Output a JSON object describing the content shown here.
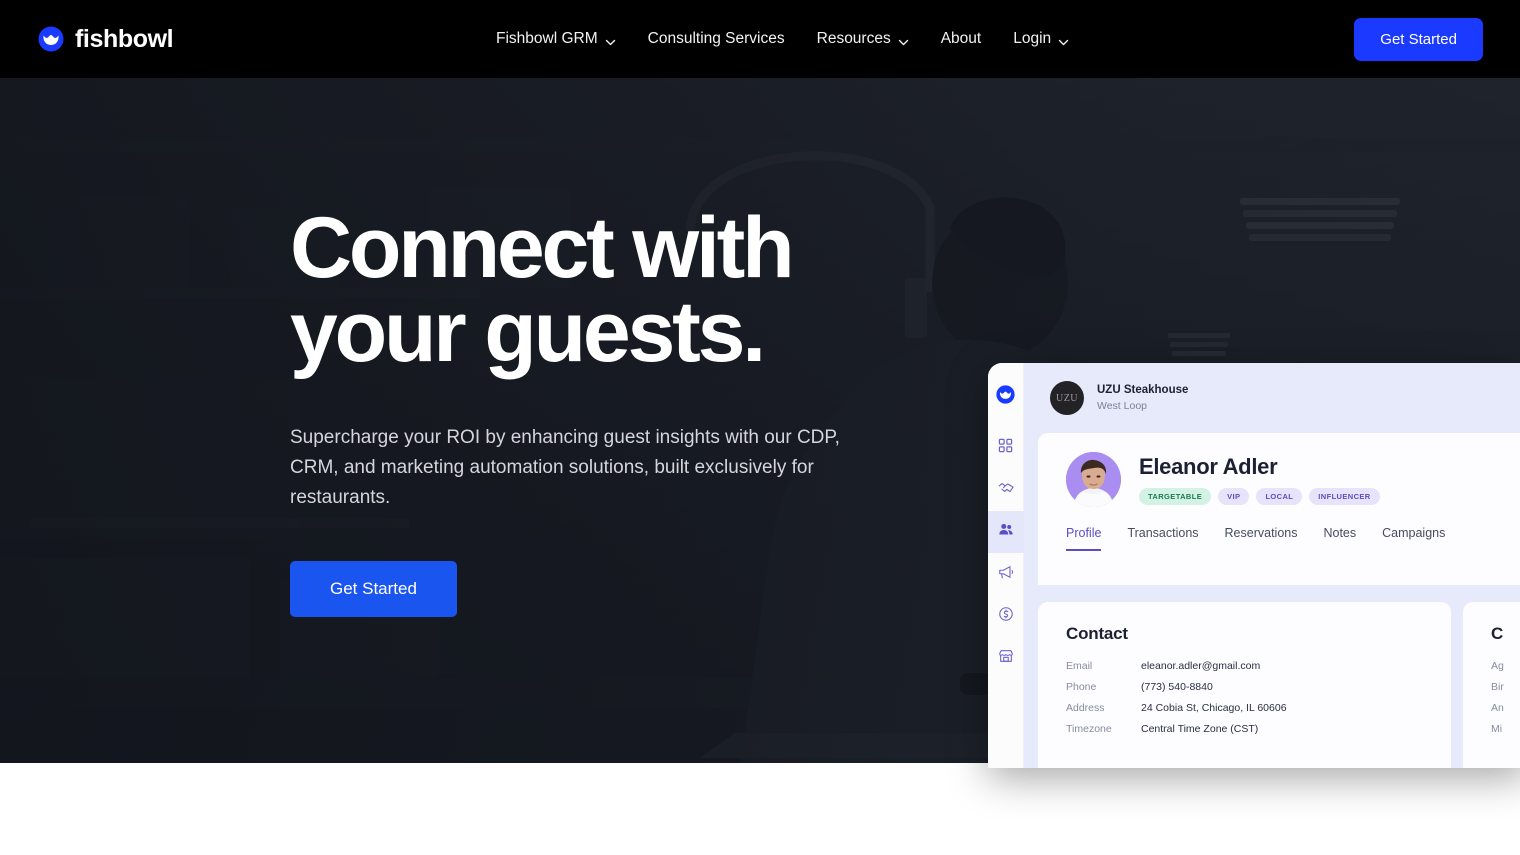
{
  "brand": {
    "name": "fishbowl",
    "logo_icon": "fishbowl-logo-icon",
    "accent": "#1a3aff"
  },
  "nav": {
    "items": [
      {
        "label": "Fishbowl GRM",
        "has_dropdown": true
      },
      {
        "label": "Consulting Services",
        "has_dropdown": false
      },
      {
        "label": "Resources",
        "has_dropdown": true
      },
      {
        "label": "About",
        "has_dropdown": false
      },
      {
        "label": "Login",
        "has_dropdown": true
      }
    ],
    "cta": "Get Started"
  },
  "hero": {
    "title": "Connect with\nyour guests.",
    "subtitle": "Supercharge your ROI by enhancing guest insights with our CDP, CRM, and marketing automation solutions, built exclusively for restaurants.",
    "cta": "Get Started",
    "background": "restaurant-kitchen-photo"
  },
  "mockup": {
    "sidebar": {
      "logo_icon": "fishbowl-logo-icon",
      "items": [
        {
          "name": "dashboard",
          "icon": "grid-icon",
          "active": false
        },
        {
          "name": "partners",
          "icon": "handshake-icon",
          "active": false
        },
        {
          "name": "guests",
          "icon": "people-icon",
          "active": true
        },
        {
          "name": "campaigns",
          "icon": "megaphone-icon",
          "active": false
        },
        {
          "name": "revenue",
          "icon": "dollar-circle-icon",
          "active": false
        },
        {
          "name": "locations",
          "icon": "storefront-icon",
          "active": false
        }
      ]
    },
    "restaurant": {
      "initials": "UZU",
      "name": "UZU Steakhouse",
      "location": "West Loop"
    },
    "guest": {
      "name": "Eleanor Adler",
      "avatar": "guest-portrait-photo",
      "badges": [
        {
          "label": "TARGETABLE",
          "color": "green"
        },
        {
          "label": "VIP",
          "color": "purple"
        },
        {
          "label": "LOCAL",
          "color": "purple"
        },
        {
          "label": "INFLUENCER",
          "color": "purple"
        }
      ]
    },
    "tabs": [
      {
        "label": "Profile",
        "active": true
      },
      {
        "label": "Transactions",
        "active": false
      },
      {
        "label": "Reservations",
        "active": false
      },
      {
        "label": "Notes",
        "active": false
      },
      {
        "label": "Campaigns",
        "active": false
      }
    ],
    "contact_card": {
      "title": "Contact",
      "rows": [
        {
          "key": "Email",
          "value": "eleanor.adler@gmail.com"
        },
        {
          "key": "Phone",
          "value": "(773) 540-8840"
        },
        {
          "key": "Address",
          "value": "24 Cobia St, Chicago, IL 60606"
        },
        {
          "key": "Timezone",
          "value": "Central Time Zone (CST)"
        }
      ]
    },
    "second_card": {
      "title": "C",
      "rows": [
        {
          "key": "Ag",
          "value": ""
        },
        {
          "key": "Bir",
          "value": ""
        },
        {
          "key": "An",
          "value": ""
        },
        {
          "key": "Mi",
          "value": ""
        }
      ]
    }
  }
}
